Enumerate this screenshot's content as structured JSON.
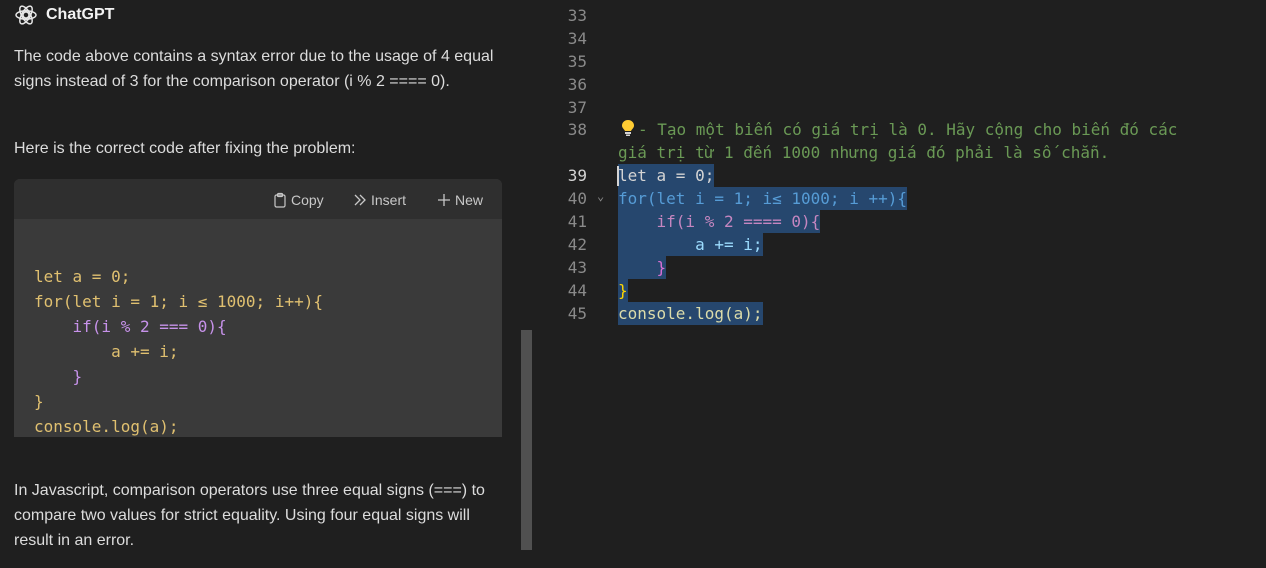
{
  "chat": {
    "title": "ChatGPT",
    "para1": "The code above contains a syntax error due to the usage of 4 equal signs instead of 3 for the comparison operator (i % 2 ==== 0).",
    "para2": "Here is the correct code after fixing the problem:",
    "para3": "In Javascript, comparison operators use three equal signs (===) to compare two values for strict equality. Using four equal signs will result in an error.",
    "toolbar": {
      "copy_label": "Copy",
      "insert_label": "Insert",
      "new_label": "New"
    },
    "code_lines": [
      "let a = 0;",
      "for(let i = 1; i ≤ 1000; i++){",
      "    if(i % 2 === 0){",
      "        a += i;",
      "    }",
      "}",
      "console.log(a);"
    ]
  },
  "editor": {
    "line_numbers": [
      "33",
      "34",
      "35",
      "36",
      "37",
      "38",
      "",
      "39",
      "40",
      "41",
      "42",
      "43",
      "44",
      "45"
    ],
    "comment_line1": "- Tạo một biến có giá trị là 0. Hãy cộng cho biến đó các",
    "comment_line2": "giá trị từ 1 đến 1000 nhưng giá đó phải là số chẵn.",
    "code_lines": [
      "let a = 0;",
      "for(let i = 1; i≤ 1000; i ++){",
      "    if(i % 2 ==== 0){",
      "        a += i;",
      "    }",
      "}",
      "console.log(a);"
    ],
    "icons": {
      "lightbulb": "lightbulb-icon",
      "fold": "chevron-down-icon"
    }
  }
}
